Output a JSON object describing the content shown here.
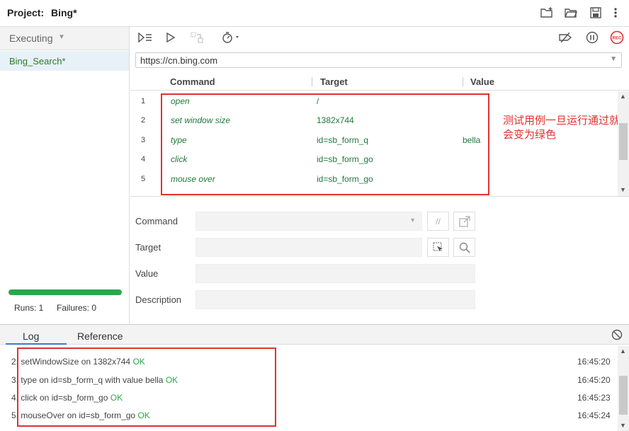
{
  "header": {
    "project_label": "Project:",
    "project_name": "Bing*"
  },
  "sidebar": {
    "mode_label": "Executing",
    "suite": "Bing_Search*",
    "runs": "Runs: 1",
    "failures": "Failures: 0",
    "progress": 1.0
  },
  "url": "https://cn.bing.com",
  "grid": {
    "headers": [
      "Command",
      "Target",
      "Value"
    ],
    "rows": [
      {
        "num": "1",
        "command": "open",
        "target": "/",
        "value": ""
      },
      {
        "num": "2",
        "command": "set window size",
        "target": "1382x744",
        "value": ""
      },
      {
        "num": "3",
        "command": "type",
        "target": "id=sb_form_q",
        "value": "bella"
      },
      {
        "num": "4",
        "command": "click",
        "target": "id=sb_form_go",
        "value": ""
      },
      {
        "num": "5",
        "command": "mouse over",
        "target": "id=sb_form_go",
        "value": ""
      }
    ]
  },
  "annotation": "测试用例一旦运行通过就会变为绿色",
  "form": {
    "command_label": "Command",
    "target_label": "Target",
    "value_label": "Value",
    "description_label": "Description",
    "comment_btn": "//"
  },
  "log": {
    "tabs": [
      "Log",
      "Reference"
    ],
    "lines": [
      {
        "text": "2. setWindowSize on 1382x744",
        "status": "OK",
        "time": "16:45:20"
      },
      {
        "text": "3. type on id=sb_form_q with value bella",
        "status": "OK",
        "time": "16:45:20"
      },
      {
        "text": "4. click on id=sb_form_go",
        "status": "OK",
        "time": "16:45:23"
      },
      {
        "text": "5. mouseOver on id=sb_form_go",
        "status": "OK",
        "time": "16:45:24"
      }
    ]
  },
  "colors": {
    "accent": "#3a7bd5",
    "pass_green": "#2aa84a",
    "annotation_red": "#e03131"
  },
  "icons": {
    "header": [
      "new-folder-icon",
      "open-folder-icon",
      "save-icon",
      "more-icon"
    ],
    "toolbar": [
      "run-all-icon",
      "run-icon",
      "step-icon",
      "speed-icon",
      "disable-breakpoints-icon",
      "pause-icon",
      "record-icon"
    ]
  }
}
